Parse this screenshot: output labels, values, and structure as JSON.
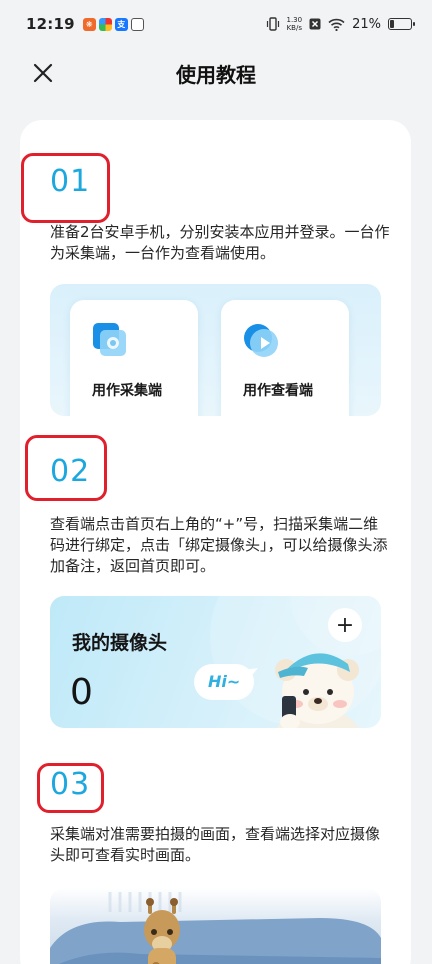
{
  "status": {
    "time": "12:19",
    "net_speed_value": "1.30",
    "net_speed_unit": "KB/s",
    "battery": "21%",
    "battery_level": 0.21
  },
  "header": {
    "title": "使用教程"
  },
  "steps": [
    {
      "number": "01",
      "text": "准备2台安卓手机，分别安装本应用并登录。一台作为采集端，一台作为查看端使用。",
      "cards": [
        {
          "label": "用作采集端",
          "icon": "camera-capture-icon"
        },
        {
          "label": "用作查看端",
          "icon": "play-view-icon"
        }
      ]
    },
    {
      "number": "02",
      "text": "查看端点击首页右上角的“+”号，扫描采集端二维码进行绑定，点击「绑定摄像头」，可以给摄像头添加备注，返回首页即可。",
      "widget": {
        "title": "我的摄像头",
        "count": "0",
        "plus": "+",
        "bubble": "Hi~"
      }
    },
    {
      "number": "03",
      "text": "采集端对准需要拍摄的画面，查看端选择对应摄像头即可查看实时画面。"
    }
  ],
  "colors": {
    "accent": "#1ca8df",
    "highlight_box": "#e0202c",
    "card_bg": "#ffffff",
    "page_bg": "#f2f3f5"
  }
}
